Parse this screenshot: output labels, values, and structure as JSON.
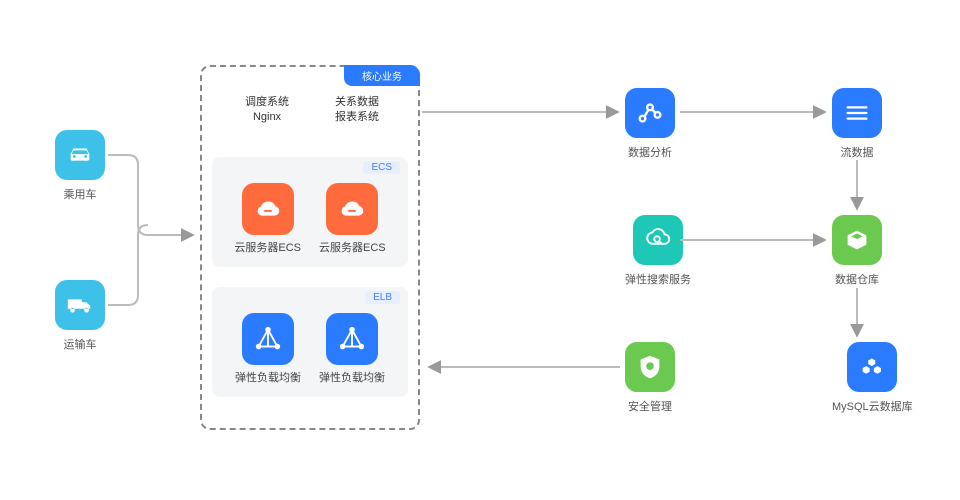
{
  "left": {
    "car": "乘用车",
    "truck": "运输车"
  },
  "center": {
    "tab": "核心业务",
    "text1_l1": "调度系统",
    "text1_l2": "Nginx",
    "text2_l1": "关系数据",
    "text2_l2": "报表系统",
    "ecs_tag": "ECS",
    "ecs_label": "云服务器ECS",
    "elb_tag": "ELB",
    "elb_label": "弹性负载均衡"
  },
  "right": {
    "analytics": "数据分析",
    "stream": "流数据",
    "cloudsearch": "弹性搜索服务",
    "bigdata": "数据仓库",
    "security": "安全管理",
    "mysql": "MySQL云数据库"
  }
}
